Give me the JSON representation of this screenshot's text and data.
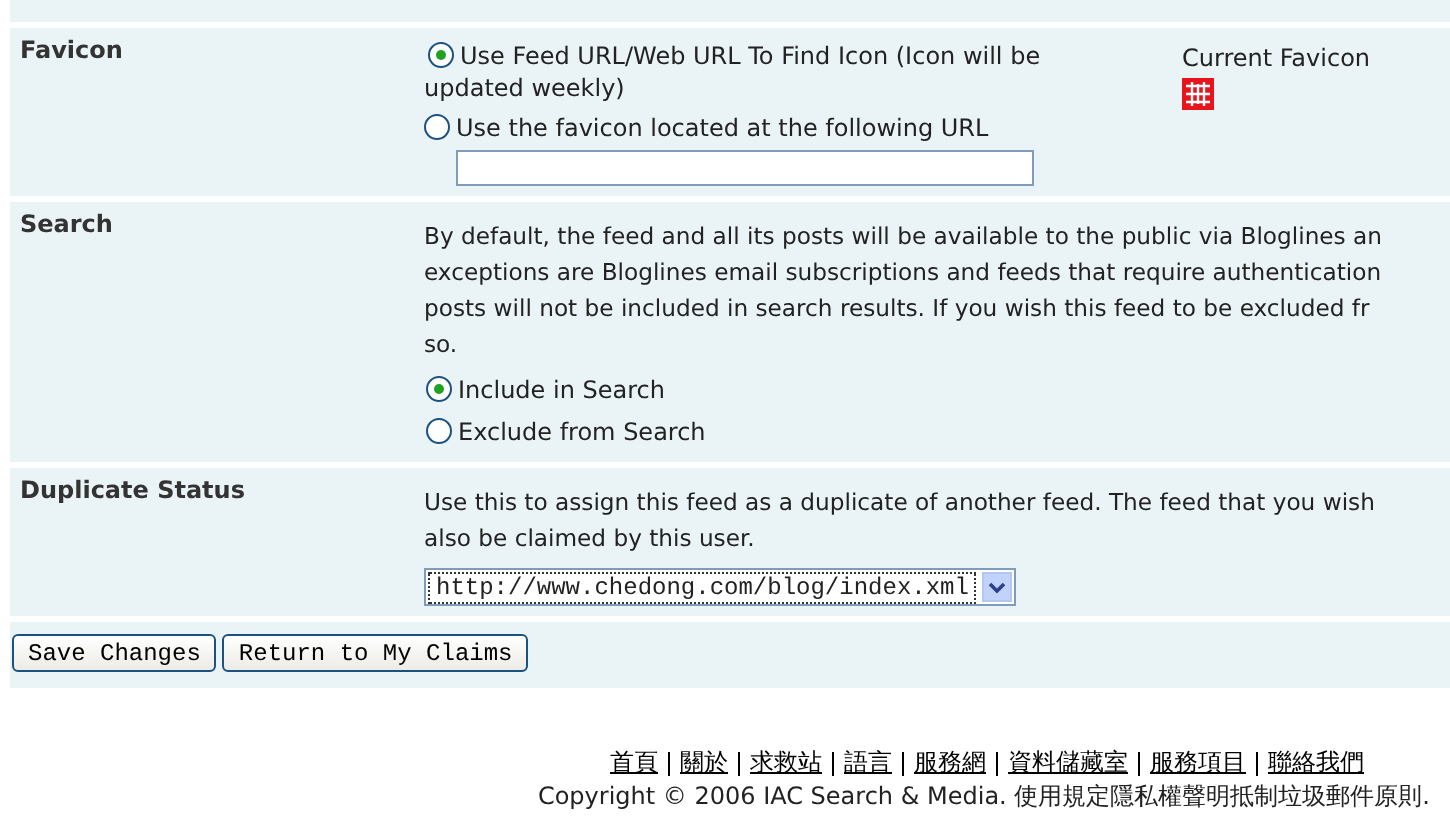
{
  "sections": [
    {
      "kind": "favicon",
      "label": "Favicon",
      "options": [
        {
          "label": "Use Feed URL/Web URL To Find Icon (Icon will be",
          "continuation": "updated weekly)",
          "selected": true
        },
        {
          "label": "Use the favicon located at the following URL",
          "selected": false
        }
      ],
      "current_label": "Current Favicon"
    },
    {
      "kind": "search",
      "label": "Search",
      "lines": [
        "By default, the feed and all its posts will be available to the public via Bloglines an",
        "exceptions are Bloglines email subscriptions and feeds that require authentication",
        "posts will not be included in search results. If you wish this feed to be excluded fr",
        "so."
      ],
      "options": [
        {
          "label": "Include in Search",
          "selected": true
        },
        {
          "label": "Exclude from Search",
          "selected": false
        }
      ]
    },
    {
      "kind": "duplicate",
      "label": "Duplicate Status",
      "lines": [
        "Use this to assign this feed as a duplicate of another feed. The feed that you wish",
        "also be claimed by this user."
      ],
      "select_value": "http://www.chedong.com/blog/index.xml"
    }
  ],
  "buttons": [
    "Save Changes",
    "Return to My Claims"
  ],
  "footer": {
    "links": [
      "首頁",
      "關於",
      "求救站",
      "語言",
      "服務網",
      "資料儲藏室",
      "服務項目",
      "聯絡我們"
    ],
    "copyright": "Copyright © 2006 IAC Search & Media. 使用規定隱私權聲明抵制垃圾郵件原則."
  }
}
